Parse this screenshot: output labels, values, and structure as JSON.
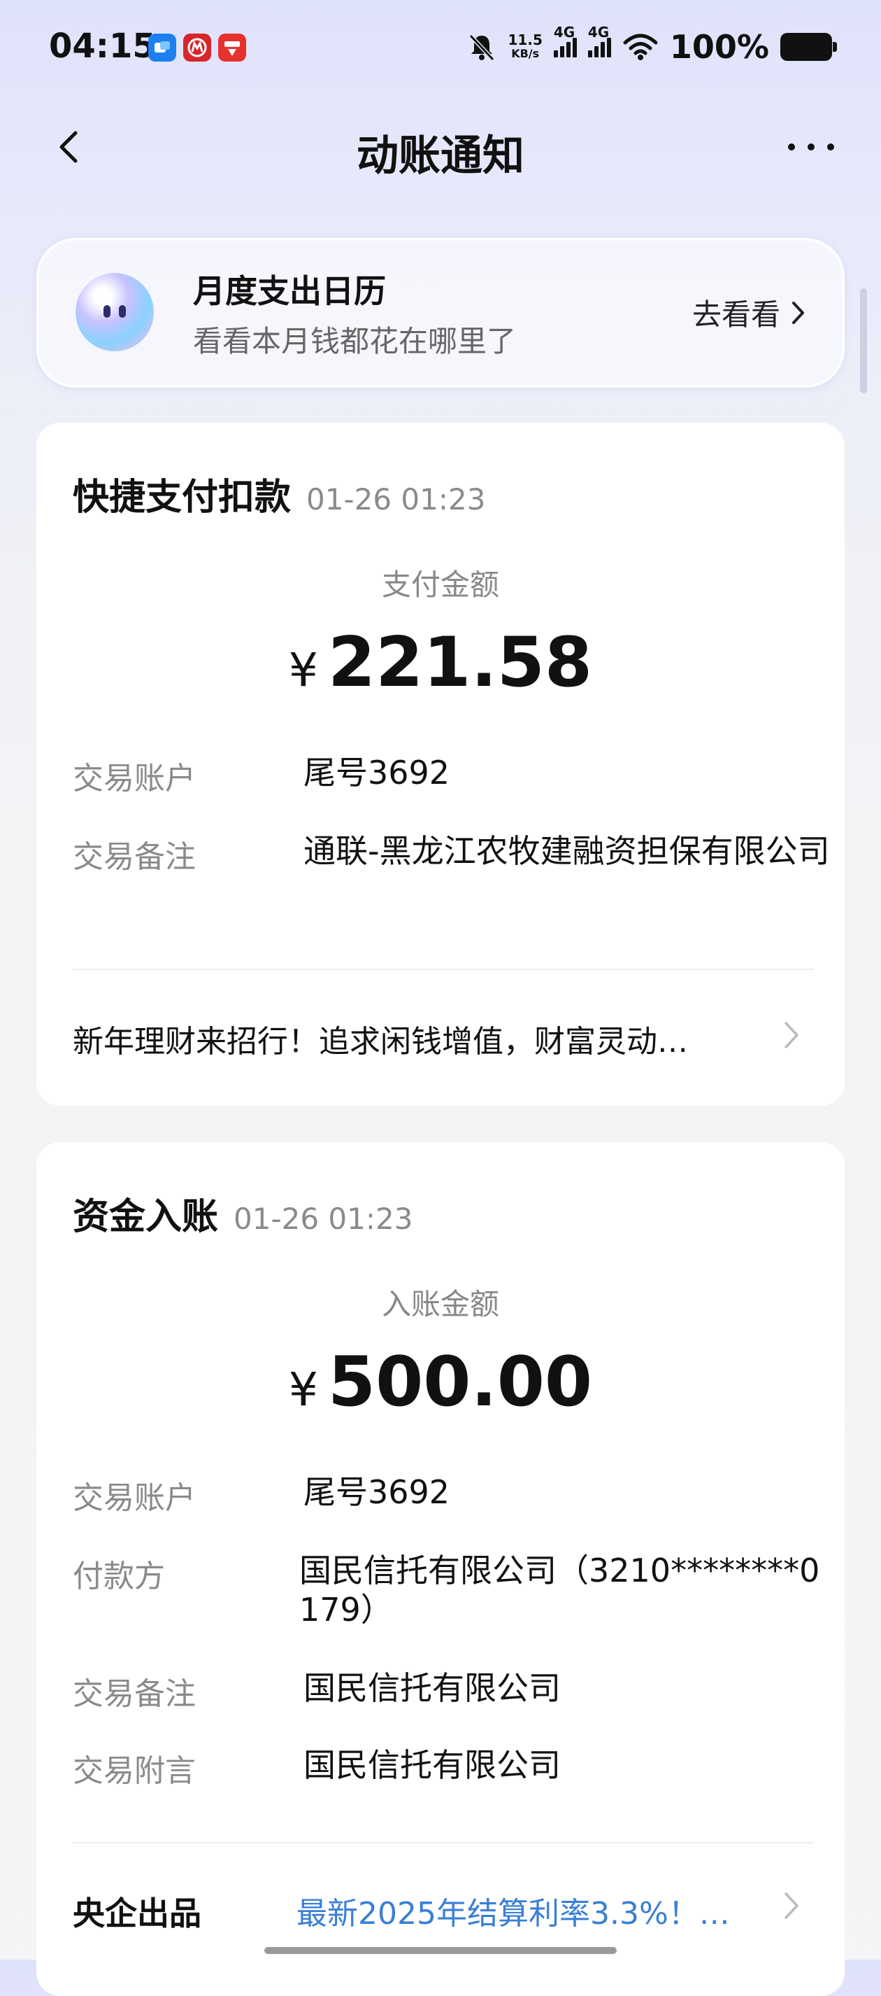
{
  "status_bar": {
    "time": "04:15",
    "net_speed_value": "11.5",
    "net_speed_unit": "KB/s",
    "signal1_label": "4G",
    "signal2_label": "4G",
    "battery": "100%",
    "apps": [
      {
        "icon": "app-blue-icon",
        "color": "#1e7ff0"
      },
      {
        "icon": "cmb-bank-icon",
        "color": "#d6262c"
      },
      {
        "icon": "cloud-pay-icon",
        "color": "#e5322d"
      }
    ]
  },
  "nav": {
    "title": "动账通知"
  },
  "banner": {
    "title": "月度支出日历",
    "subtitle": "看看本月钱都花在哪里了",
    "action": "去看看"
  },
  "cards": [
    {
      "type": "快捷支付扣款",
      "time": "01-26 01:23",
      "amount_label": "支付金额",
      "currency": "¥",
      "amount": "221.58",
      "rows": [
        {
          "label": "交易账户",
          "value": "尾号3692"
        },
        {
          "label": "交易备注",
          "value": "通联-黑龙江农牧建融资担保有限公司"
        }
      ],
      "promo": "新年理财来招行！追求闲钱增值，财富灵动…"
    },
    {
      "type": "资金入账",
      "time": "01-26 01:23",
      "amount_label": "入账金额",
      "currency": "¥",
      "amount": "500.00",
      "rows": [
        {
          "label": "交易账户",
          "value": "尾号3692"
        },
        {
          "label": "付款方",
          "value": "国民信托有限公司（3210********0179）"
        },
        {
          "label": "交易备注",
          "value": "国民信托有限公司"
        },
        {
          "label": "交易附言",
          "value": "国民信托有限公司"
        }
      ],
      "promo_brand": "央企出品",
      "promo_link": "最新2025年结算利率3.3%！…"
    }
  ],
  "colors": {
    "link": "#3a7fd6",
    "muted": "#8a8a8a"
  }
}
